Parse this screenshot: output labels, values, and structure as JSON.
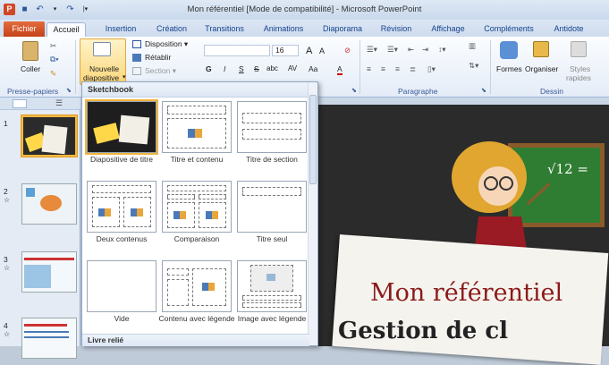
{
  "window": {
    "title": "Mon référentiel [Mode de compatibilité] - Microsoft PowerPoint",
    "app_icon": "P"
  },
  "tabs": [
    {
      "label": "Fichier"
    },
    {
      "label": "Accueil"
    },
    {
      "label": "Insertion"
    },
    {
      "label": "Création"
    },
    {
      "label": "Transitions"
    },
    {
      "label": "Animations"
    },
    {
      "label": "Diaporama"
    },
    {
      "label": "Révision"
    },
    {
      "label": "Affichage"
    },
    {
      "label": "Compléments"
    },
    {
      "label": "Antidote"
    }
  ],
  "ribbon": {
    "paste_label": "Coller",
    "new_slide_label_1": "Nouvelle",
    "new_slide_label_2": "diapositive",
    "disposition_label": "Disposition ▾",
    "retablir_label": "Rétablir",
    "section_label": "Section ▾",
    "font_size": "16",
    "grow_font": "A",
    "shrink_font": "A",
    "bold": "G",
    "italic": "I",
    "underline": "S",
    "strike": "S",
    "shadow": "abc",
    "spacing": "AV",
    "case": "Aa",
    "font_color": "A",
    "shapes_label": "Formes",
    "arrange_label": "Organiser",
    "styles_label_1": "Styles",
    "styles_label_2": "rapides",
    "groups": {
      "clipboard": "Presse-papiers",
      "paragraph": "Paragraphe",
      "drawing": "Dessin"
    }
  },
  "gallery": {
    "header": "Sketchbook",
    "footer": "Livre relié",
    "layouts": [
      {
        "label": "Diapositive de titre"
      },
      {
        "label": "Titre et contenu"
      },
      {
        "label": "Titre de section"
      },
      {
        "label": "Deux contenus"
      },
      {
        "label": "Comparaison"
      },
      {
        "label": "Titre seul"
      },
      {
        "label": "Vide"
      },
      {
        "label": "Contenu avec légende"
      },
      {
        "label": "Image avec légende"
      }
    ]
  },
  "thumbnails": [
    {
      "number": "1"
    },
    {
      "number": "2"
    },
    {
      "number": "3"
    },
    {
      "number": "4"
    }
  ],
  "slide": {
    "board_text": "√12 =",
    "title": "Mon référentiel",
    "subtitle": "Gestion de cl"
  },
  "colors": {
    "file_tab": "#d24726",
    "accent_selection": "#f0b53b",
    "title_red": "#8b1a1a",
    "board_green": "#2f7d32"
  }
}
